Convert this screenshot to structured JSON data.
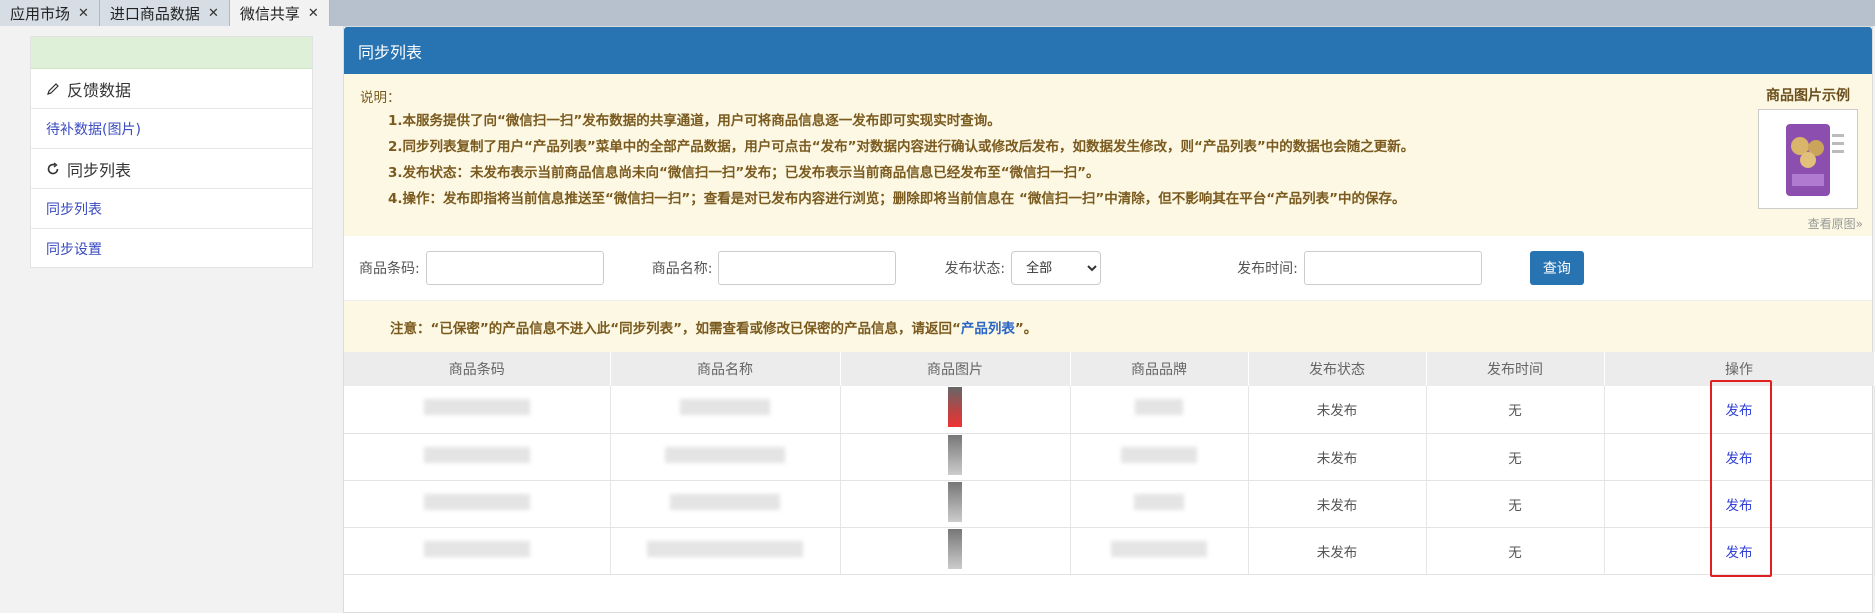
{
  "tabs": [
    {
      "label": "应用市场",
      "active": false
    },
    {
      "label": "进口商品数据",
      "active": false
    },
    {
      "label": "微信共享",
      "active": true
    }
  ],
  "sidebar": {
    "feedback_title": "反馈数据",
    "feedback_link": "待补数据(图片)",
    "sync_title": "同步列表",
    "sync_list_link": "同步列表",
    "sync_settings_link": "同步设置"
  },
  "panel": {
    "title": "同步列表",
    "notice_title": "说明：",
    "notice_lines": [
      "1.本服务提供了向“微信扫一扫”发布数据的共享通道，用户可将商品信息逐一发布即可实现实时查询。",
      "2.同步列表复制了用户“产品列表”菜单中的全部产品数据，用户可点击“发布”对数据内容进行确认或修改后发布，如数据发生修改，则“产品列表”中的数据也会随之更新。",
      "3.发布状态：未发布表示当前商品信息尚未向“微信扫一扫”发布；已发布表示当前商品信息已经发布至“微信扫一扫”。",
      "4.操作：发布即指将当前信息推送至“微信扫一扫”；查看是对已发布内容进行浏览；删除即将当前信息在 “微信扫一扫”中清除，但不影响其在平台“产品列表”中的保存。"
    ],
    "example_title": "商品图片示例",
    "example_link": "查看原图»"
  },
  "filter": {
    "barcode_label": "商品条码:",
    "name_label": "商品名称:",
    "status_label": "发布状态:",
    "status_selected": "全部",
    "time_label": "发布时间:",
    "query_button": "查询"
  },
  "warning": {
    "text_before": "注意：“已保密”的产品信息不进入此“同步列表”，如需查看或修改已保密的产品信息，请返回“",
    "link": "产品列表",
    "text_after": "”。"
  },
  "table": {
    "headers": [
      "商品条码",
      "商品名称",
      "商品图片",
      "商品品牌",
      "发布状态",
      "发布时间",
      "操作"
    ],
    "rows": [
      {
        "status": "未发布",
        "time": "无",
        "action": "发布"
      },
      {
        "status": "未发布",
        "time": "无",
        "action": "发布"
      },
      {
        "status": "未发布",
        "time": "无",
        "action": "发布"
      },
      {
        "status": "未发布",
        "time": "无",
        "action": "发布"
      }
    ]
  },
  "colors": {
    "header_blue": "#2874b3",
    "notice_bg": "#fcf8e3",
    "link_blue": "#3140d8",
    "highlight_red": "#e02020"
  }
}
